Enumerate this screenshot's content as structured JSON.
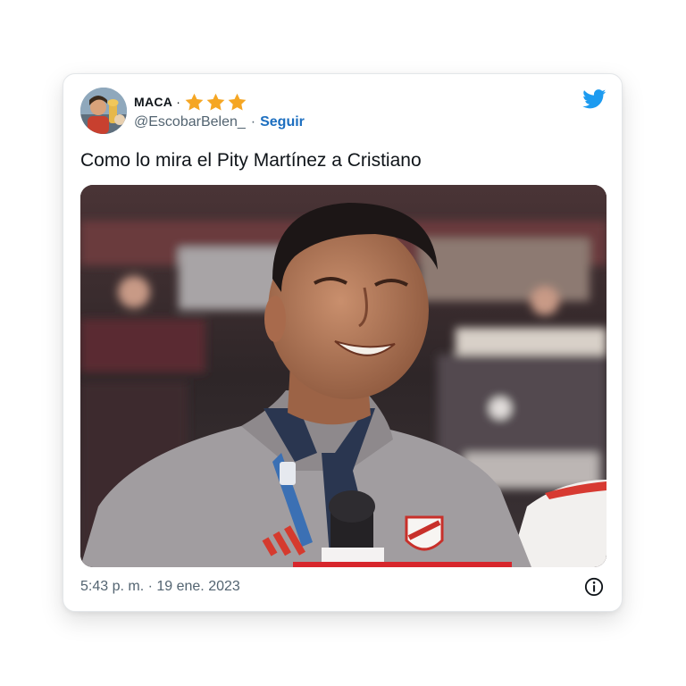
{
  "tweet": {
    "author_name": "MACA",
    "name_separator": "·",
    "badge_stars": 3,
    "handle": "@EscobarBelen_",
    "handle_separator": "·",
    "follow_label": "Seguir",
    "text": "Como lo mira el Pity Martínez a Cristiano",
    "timestamp": "5:43 p. m. · 19 ene. 2023"
  },
  "icons": {
    "brand": "twitter-bird-icon",
    "info": "info-icon",
    "star": "star-icon"
  },
  "colors": {
    "brand_blue": "#1d9bf0",
    "follow_blue": "#1d6fc0",
    "star_gold": "#f5a623",
    "text_primary": "#0f1419",
    "text_secondary": "#536471"
  }
}
